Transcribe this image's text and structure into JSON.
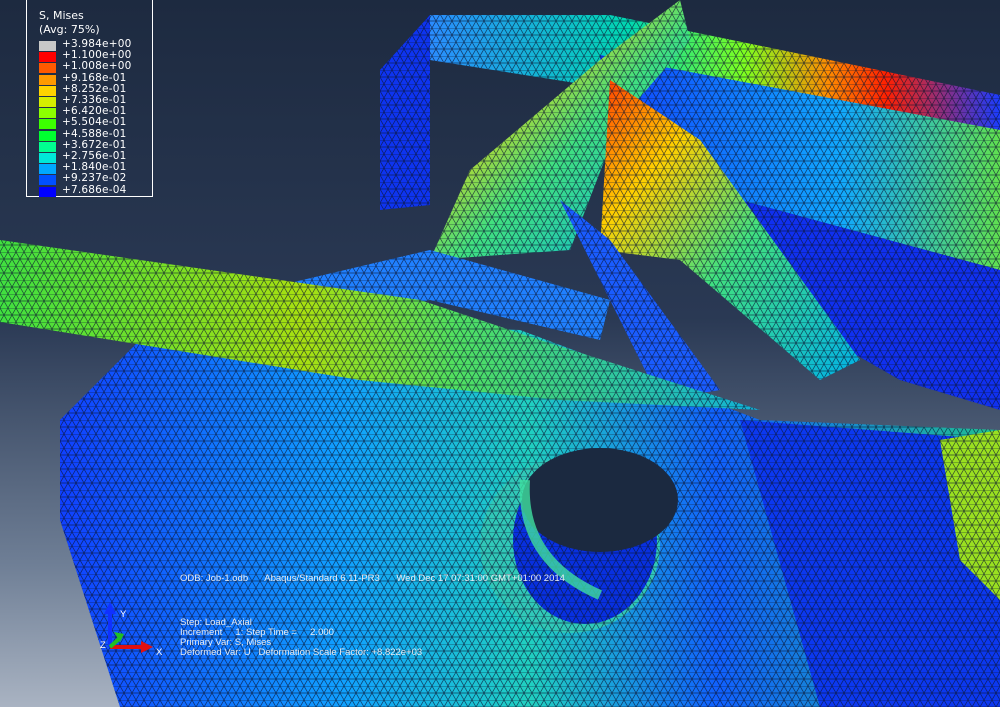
{
  "legend": {
    "title": "S, Mises",
    "subtitle": "(Avg: 75%)",
    "entries": [
      {
        "label": "+3.984e+00",
        "color": "#c8c8c8"
      },
      {
        "label": "+1.100e+00",
        "color": "#ff0000"
      },
      {
        "label": "+1.008e+00",
        "color": "#ff5a00"
      },
      {
        "label": "+9.168e-01",
        "color": "#ff9a00"
      },
      {
        "label": "+8.252e-01",
        "color": "#ffd300"
      },
      {
        "label": "+7.336e-01",
        "color": "#d6ee00"
      },
      {
        "label": "+6.420e-01",
        "color": "#8cff00"
      },
      {
        "label": "+5.504e-01",
        "color": "#3cff00"
      },
      {
        "label": "+4.588e-01",
        "color": "#00ff30"
      },
      {
        "label": "+3.672e-01",
        "color": "#00ff90"
      },
      {
        "label": "+2.756e-01",
        "color": "#00e8d8"
      },
      {
        "label": "+1.840e-01",
        "color": "#00a8ff"
      },
      {
        "label": "+9.237e-02",
        "color": "#0050ff"
      },
      {
        "label": "+7.686e-04",
        "color": "#0000ff"
      }
    ]
  },
  "odb": {
    "file": "ODB: Job-1.odb",
    "solver": "Abaqus/Standard 6.11-PR3",
    "date": "Wed Dec 17 07:31:00 GMT+01:00 2014"
  },
  "info": {
    "step": "Step: Load_Axial",
    "increment": "Increment     1: Step Time =     2.000",
    "primary_var": "Primary Var: S, Mises",
    "deformed_var": "Deformed Var: U   Deformation Scale Factor: +8.822e+03"
  },
  "triad": {
    "x": "X",
    "y": "Y",
    "z": "Z"
  },
  "colors": {
    "bg_top": "#1d2a40",
    "bg_bottom": "#a9b3c2",
    "mesh": "#0a1430"
  }
}
